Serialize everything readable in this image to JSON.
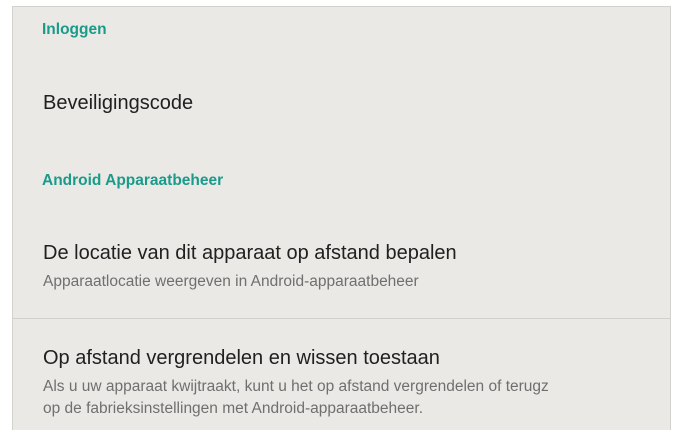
{
  "sections": [
    {
      "header": "Inloggen",
      "items": [
        {
          "title": "Beveiligingscode"
        }
      ]
    },
    {
      "header": "Android Apparaatbeheer",
      "items": [
        {
          "title": "De locatie van dit apparaat op afstand bepalen",
          "summary": "Apparaatlocatie weergeven in Android-apparaatbeheer"
        },
        {
          "title": "Op afstand vergrendelen en wissen toestaan",
          "summary_line1": "Als u uw apparaat kwijtraakt, kunt u het op afstand vergrendelen of terugz",
          "summary_line2": "op de fabrieksinstellingen met Android-apparaatbeheer."
        }
      ]
    }
  ],
  "colors": {
    "accent": "#1a9b8a",
    "background": "#ebe9e6",
    "title_text": "#202020",
    "summary_text": "#6f6f6f",
    "divider": "#d2d0cd"
  }
}
